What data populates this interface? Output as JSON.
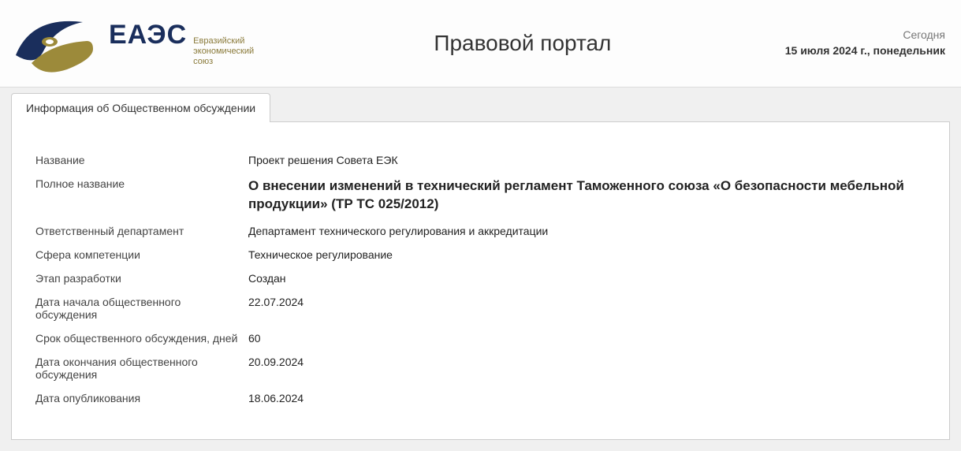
{
  "header": {
    "logo_acronym": "ЕАЭС",
    "logo_sub_line1": "Евразийский",
    "logo_sub_line2": "экономический",
    "logo_sub_line3": "союз",
    "portal_title": "Правовой портал",
    "today_label": "Сегодня",
    "today_date": "15 июля 2024 г., понедельник"
  },
  "tab": {
    "label": "Информация об Общественном обсуждении"
  },
  "info": {
    "rows": [
      {
        "label": "Название",
        "value": "Проект решения Совета ЕЭК"
      },
      {
        "label": "Полное название",
        "value": "О внесении изменений в технический регламент Таможенного союза «О безопасности мебельной продукции» (ТР ТС 025/2012)",
        "full": true
      },
      {
        "label": "Ответственный департамент",
        "value": "Департамент технического регулирования и аккредитации"
      },
      {
        "label": "Сфера компетенции",
        "value": "Техническое регулирование"
      },
      {
        "label": "Этап разработки",
        "value": "Создан"
      },
      {
        "label": "Дата начала общественного обсуждения",
        "value": "22.07.2024"
      },
      {
        "label": "Срок общественного обсуждения, дней",
        "value": "60"
      },
      {
        "label": "Дата окончания общественного обсуждения",
        "value": "20.09.2024"
      },
      {
        "label": "Дата опубликования",
        "value": "18.06.2024"
      }
    ]
  }
}
